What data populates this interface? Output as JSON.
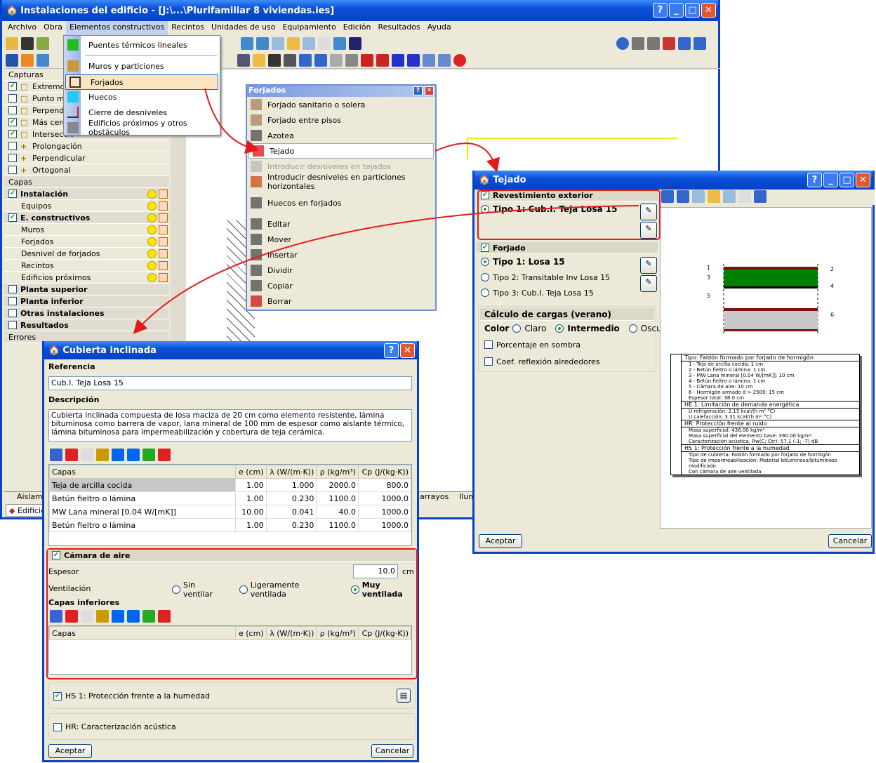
{
  "main": {
    "title": "Instalaciones del edificio - [J:\\...\\Plurifamiliar 8 viviendas.ies]",
    "menu": [
      "Archivo",
      "Obra",
      "Elementos constructivos",
      "Recintos",
      "Unidades de uso",
      "Equipamiento",
      "Edición",
      "Resultados",
      "Ayuda"
    ],
    "capturas_title": "Capturas",
    "capturas": [
      {
        "label": "Extremo",
        "checked": true
      },
      {
        "label": "Punto me",
        "checked": false
      },
      {
        "label": "Perpendic",
        "checked": false
      },
      {
        "label": "Más cerc",
        "checked": true
      },
      {
        "label": "Interseccio",
        "checked": true
      },
      {
        "label": "Prolongación",
        "checked": false
      },
      {
        "label": "Perpendicular",
        "checked": false
      },
      {
        "label": "Ortogonal",
        "checked": false
      }
    ],
    "capas_title": "Capas",
    "capas": [
      {
        "label": "Instalación",
        "bold": true,
        "check": true
      },
      {
        "label": "Equipos"
      },
      {
        "label": "E. constructivos",
        "bold": true,
        "check": true
      },
      {
        "label": "Muros"
      },
      {
        "label": "Forjados"
      },
      {
        "label": "Desnivel de forjados"
      },
      {
        "label": "Recintos"
      },
      {
        "label": "Edificios próximos"
      }
    ],
    "groups": [
      "Planta superior",
      "Planta inferior",
      "Otras instalaciones",
      "Resultados"
    ],
    "errores": "Errores",
    "bottom_tabs": [
      "Aislamie",
      "Edificio",
      "arrayos",
      "Ilumi"
    ]
  },
  "dropdown": [
    "Puentes térmicos lineales",
    "Muros y particiones",
    "Forjados",
    "Huecos",
    "Cierre de desniveles",
    "Edificios próximos y otros obstáculos"
  ],
  "forjados": {
    "title": "Forjados",
    "items": [
      "Forjado sanitario o solera",
      "Forjado entre pisos",
      "Azotea",
      "Tejado",
      "Introducir desniveles en tejados",
      "Introducir desniveles en particiones horizontales",
      "Huecos en forjados",
      "Editar",
      "Mover",
      "Insertar",
      "Dividir",
      "Copiar",
      "Borrar"
    ]
  },
  "tejado": {
    "title": "Tejado",
    "rev_title": "Revestimiento exterior",
    "rev_option": "Tipo 1: Cub.I. Teja Losa 15",
    "forjado_title": "Forjado",
    "forjado_options": [
      "Tipo 1: Losa 15",
      "Tipo 2: Transitable Inv Losa 15",
      "Tipo 3: Cub.I. Teja Losa 15"
    ],
    "cargas_title": "Cálculo de cargas (verano)",
    "color_label": "Color",
    "colors": [
      "Claro",
      "Intermedio",
      "Oscuro"
    ],
    "sombra": "Porcentaje en sombra",
    "reflexion": "Coef. reflexión alrededores",
    "diagram_labels": [
      "1",
      "2",
      "3",
      "4",
      "5",
      "6"
    ],
    "info": {
      "tipo": "Tipo: Faldón formado por forjado de hormigón",
      "layers": [
        "1 - Teja de arcilla cocida: 1 cm",
        "2 - Betún fieltro o lámina: 1 cm",
        "3 - MW Lana mineral [0.04 W/[mK]]: 10 cm",
        "4 - Betún fieltro o lámina: 1 cm",
        "5 - Cámara de aire: 10 cm",
        "6 - Hormigón armado d > 2500: 15 cm"
      ],
      "espesor": "Espesor total: 38.0 cm",
      "he1": "HE 1: Limitación de demanda energética",
      "he1_lines": [
        "U refrigeración: 2.15 kcal/(h m² °C)",
        "U calefacción: 3.31 kcal/(h m² °C)"
      ],
      "hr": "HR: Protección frente al ruido",
      "hr_lines": [
        "Masa superficial: 436.00 kg/m²",
        "Masa superficial del elemento base: 390.00 kg/m²",
        "Caracterización acústica, Rw(C; Ctr): 57.1 (-1; -7) dB"
      ],
      "hs1": "HS 1: Protección frente a la humedad",
      "hs1_lines": [
        "Tipo de cubierta: Faldón formado por forjado de hormigón",
        "Tipo de impermeabilización: Material bituminoso/bituminoso modificado",
        "Con cámara de aire ventilada"
      ]
    },
    "ok": "Aceptar",
    "cancel": "Cancelar"
  },
  "cubierta": {
    "title": "Cubierta inclinada",
    "ref_label": "Referencia",
    "ref_value": "Cub.I. Teja Losa 15",
    "desc_label": "Descripción",
    "desc_value": "Cubierta inclinada compuesta de losa maciza de 20 cm como elemento resistente, lámina bituminosa como barrera de vapor, lana mineral de 100 mm de espesor como aislante térmico, lámina bituminosa para impermeabilización y cobertura de teja cerámica.",
    "columns": [
      "Capas",
      "e (cm)",
      "λ (W/(m·K))",
      "ρ (kg/m³)",
      "Cp (J/(kg·K))"
    ],
    "rows": [
      [
        "Teja de arcilla cocida",
        "1.00",
        "1.000",
        "2000.0",
        "800.0"
      ],
      [
        "Betún fieltro o lámina",
        "1.00",
        "0.230",
        "1100.0",
        "1000.0"
      ],
      [
        "MW Lana mineral [0.04 W/[mK]]",
        "10.00",
        "0.041",
        "40.0",
        "1000.0"
      ],
      [
        "Betún fieltro o lámina",
        "1.00",
        "0.230",
        "1100.0",
        "1000.0"
      ]
    ],
    "camara": "Cámara de aire",
    "espesor_label": "Espesor",
    "espesor_value": "10.0",
    "espesor_unit": "cm",
    "ventilacion": "Ventilación",
    "vent_options": [
      "Sin ventilar",
      "Ligeramente ventilada",
      "Muy ventilada"
    ],
    "capas_inf": "Capas inferiores",
    "hs1": "HS 1: Protección frente a la humedad",
    "hr": "HR: Caracterización acústica",
    "ok": "Aceptar",
    "cancel": "Cancelar"
  }
}
